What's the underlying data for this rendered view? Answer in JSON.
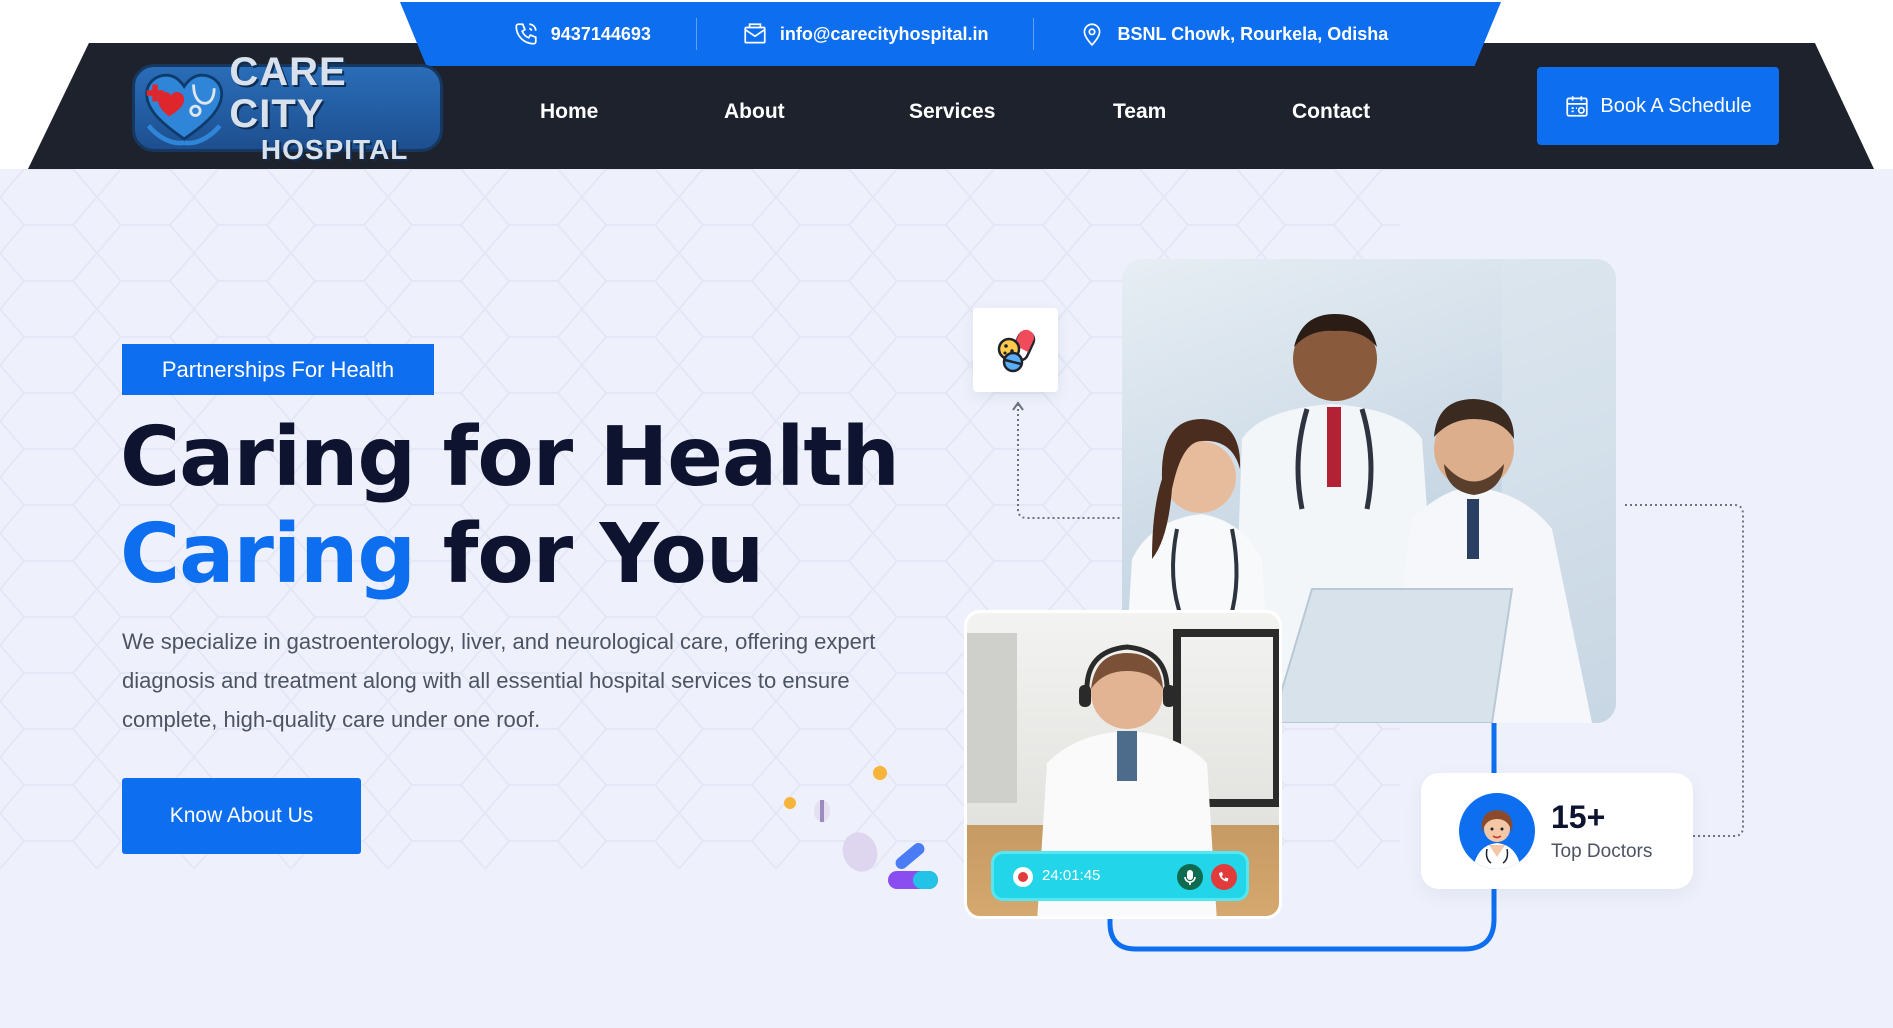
{
  "topbar": {
    "phone": "9437144693",
    "email": "info@carecityhospital.in",
    "address": "BSNL Chowk, Rourkela, Odisha"
  },
  "logo": {
    "line1": "CARE CITY",
    "line2": "HOSPITAL"
  },
  "nav": {
    "items": [
      {
        "label": "Home"
      },
      {
        "label": "About"
      },
      {
        "label": "Services"
      },
      {
        "label": "Team"
      },
      {
        "label": "Contact"
      }
    ],
    "cta": "Book A Schedule"
  },
  "hero": {
    "tag": "Partnerships For Health",
    "headline_line1": "Caring for Health",
    "headline_accent": "Caring",
    "headline_rest": " for You",
    "description": "We specialize in gastroenterology, liver, and neurological care, offering expert diagnosis and treatment along with all essential hospital services to ensure complete, high-quality care under one roof.",
    "cta": "Know About Us",
    "call_timer": "24:01:45",
    "doctors_count": "15+",
    "doctors_label": "Top Doctors"
  },
  "colors": {
    "primary": "#0d6ef0",
    "navbar_bg": "#1e222c",
    "hero_bg": "#eef1fb",
    "heading": "#0e1430"
  }
}
